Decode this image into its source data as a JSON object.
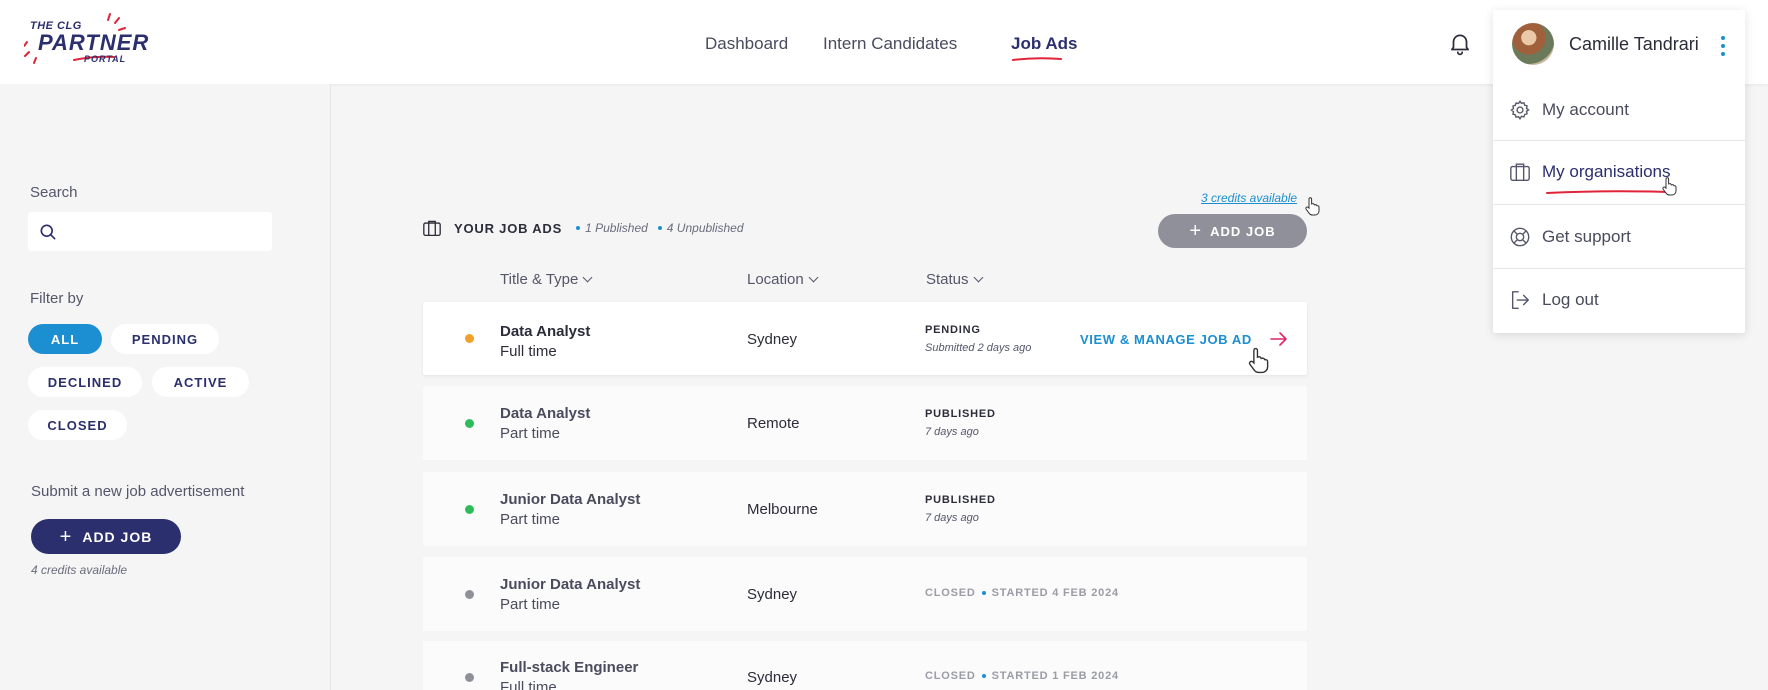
{
  "brand": {
    "logo_line1": "THE CLG",
    "logo_line2": "PARTNER",
    "logo_line3": "PORTAL"
  },
  "nav": {
    "items": [
      {
        "label": "Dashboard"
      },
      {
        "label": "Intern Candidates"
      },
      {
        "label": "Job Ads"
      }
    ],
    "active": "Job Ads"
  },
  "sidebar": {
    "search_label": "Search",
    "search_value": "",
    "filter_label": "Filter by",
    "filters": [
      "ALL",
      "PENDING",
      "DECLINED",
      "ACTIVE",
      "CLOSED"
    ],
    "active_filter": "ALL",
    "submit_label": "Submit a new job advertisement",
    "add_job_label": "ADD JOB",
    "credits": "4 credits available"
  },
  "main": {
    "credits_link": "3 credits available",
    "section_title": "YOUR JOB ADS",
    "published_count": "1 Published",
    "unpublished_count": "4 Unpublished",
    "add_job_label": "ADD JOB",
    "columns": [
      "Title & Type",
      "Location",
      "Status"
    ],
    "rows": [
      {
        "title": "Data Analyst",
        "type": "Full time",
        "location": "Sydney",
        "status": "PENDING",
        "status_sub": "Submitted 2 days ago",
        "action": "VIEW & MANAGE JOB AD",
        "dot_color": "#f0a12b"
      },
      {
        "title": "Data Analyst",
        "type": "Part time",
        "location": "Remote",
        "status": "PUBLISHED",
        "status_sub": "7 days ago",
        "dot_color": "#2ebc5a"
      },
      {
        "title": "Junior Data Analyst",
        "type": "Part time",
        "location": "Melbourne",
        "status": "PUBLISHED",
        "status_sub": "7 days ago",
        "dot_color": "#2ebc5a"
      },
      {
        "title": "Junior Data Analyst",
        "type": "Part time",
        "location": "Sydney",
        "status": "CLOSED",
        "status_sub": "STARTED 4 FEB 2024",
        "dot_color": "#8f9099"
      },
      {
        "title": "Full-stack Engineer",
        "type": "Full time",
        "location": "Sydney",
        "status": "CLOSED",
        "status_sub": "STARTED 1 FEB 2024",
        "dot_color": "#8f9099"
      }
    ]
  },
  "user_menu": {
    "name": "Camille Tandrari",
    "items": [
      {
        "label": "My account",
        "icon": "gear-icon"
      },
      {
        "label": "My organisations",
        "icon": "briefcase-icon"
      },
      {
        "label": "Get support",
        "icon": "lifebuoy-icon"
      },
      {
        "label": "Log out",
        "icon": "logout-icon"
      }
    ],
    "active": "My organisations"
  },
  "colors": {
    "brand_navy": "#2b2f6e",
    "accent_blue": "#1b8fd2",
    "accent_red": "#e0243a",
    "pending": "#f0a12b",
    "published": "#2ebc5a",
    "closed": "#8f9099"
  }
}
